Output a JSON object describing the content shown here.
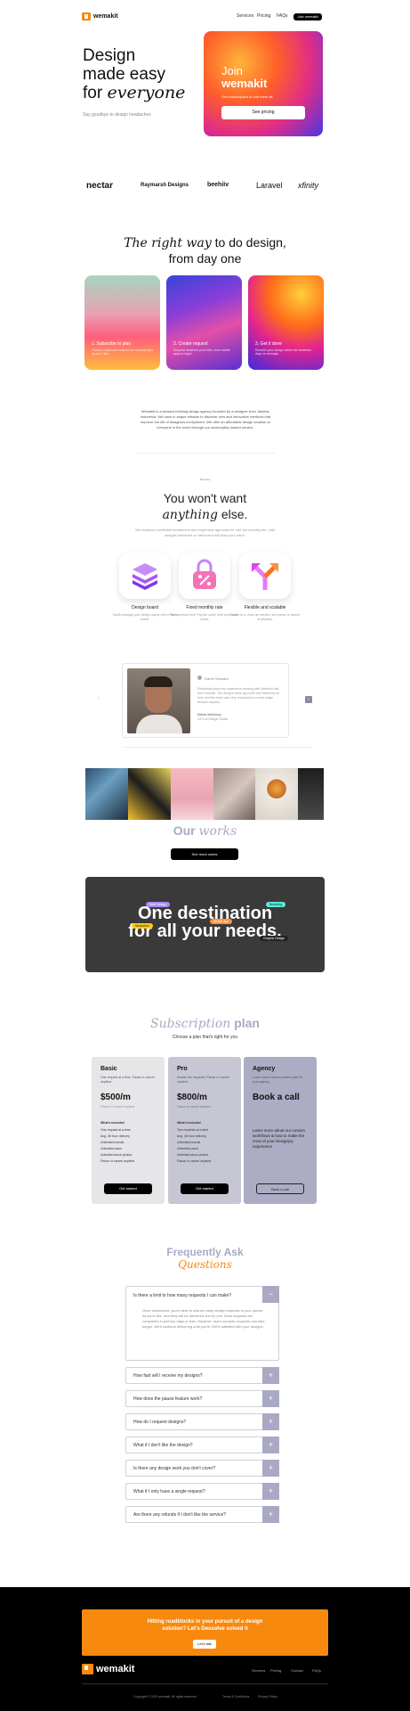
{
  "header": {
    "brand": "wemakit",
    "nav": [
      "Services",
      "Pricing",
      "FAQs"
    ],
    "cta": "Join wemakit"
  },
  "hero": {
    "line1": "Design",
    "line2": "made easy",
    "line3_plain": "for",
    "line3_italic": "everyone",
    "sub": "Say goodbye to design headaches",
    "card_title_1": "Join",
    "card_title_2": "wemakit",
    "card_sub": "One subscription to rule them all.",
    "card_btn": "See pricing"
  },
  "logos": [
    "nectar",
    "Raymarsh Designs",
    "beehiiv",
    "Laravel",
    "xfinity"
  ],
  "intro": {
    "title_italic": "The right way",
    "title_rest": "to do design,",
    "title_line2": "from day one"
  },
  "features": [
    {
      "title": "1. Subscribe to plan",
      "desc": "Choose a plan and request as many designs as you'd like."
    },
    {
      "title": "2. Create request",
      "desc": "Request whatever you'd like, from mobile apps to logos."
    },
    {
      "title": "3. Get it done",
      "desc": "Receive your design within two business days on average."
    }
  ],
  "about": {
    "p1": "Wemakit is a forward-thinking design agency founded by a designer from Jakarta, Indonesia. We have a unique mission to discover new and innovative methods that improve the life of designers everywhere. We offer an affordable design solution to everyone in the world through our subscription-based service."
  },
  "services_section": {
    "tag": "Services",
    "title1": "You won't want",
    "title2_italic": "anything",
    "title2_rest": "else.",
    "sub": "We replaced unreliable freelancers and expensive agencies for one flat monthly fee, with designs delivered so fast that it will blow your mind."
  },
  "services": [
    {
      "icon": "layers-icon",
      "title": "Design board",
      "desc": "Easily manage your design queue with a Trello board."
    },
    {
      "icon": "percent-icon",
      "title": "Fixed monthly rate",
      "desc": "No surprises here! Pay the same fixed price each month."
    },
    {
      "icon": "split-arrow-icon",
      "title": "Flexible and scalable",
      "desc": "Scale up or down as needed, and pause or cancel at anytime."
    }
  ],
  "testimonial": {
    "name": "Darrel Steward",
    "quote": "Everything about my experience working with Wemakit has been smooth. The designs were top notch and delivered on time, and the team was very responsive to every single revision request.",
    "author": "Marvin McKinney",
    "role": "CEO at Design Studio"
  },
  "works": {
    "title_plain": "Our",
    "title_italic": "works",
    "btn": "See more works"
  },
  "destination": {
    "line1": "One destination",
    "line2": "for all your needs.",
    "tags": [
      "Web Design",
      "Branding",
      "Mobile App",
      "Illustration",
      "Graphic Design"
    ]
  },
  "pricing": {
    "title_italic": "Subscription",
    "title_rest": "plan",
    "sub": "Choose a plan that's right for you",
    "plans": [
      {
        "name": "Basic",
        "sub": "One request at a time. Pause or cancel anytime.",
        "price": "$500/m",
        "price_note": "Pause or cancel anytime",
        "features_label": "What's included",
        "features": [
          "One request at a time",
          "Avg. 48 hour delivery",
          "Unlimited brands",
          "Unlimited users",
          "Unlimited stock photos",
          "Pause or cancel anytime"
        ],
        "btn": "Get started"
      },
      {
        "name": "Pro",
        "sub": "Double the requests. Pause or cancel anytime.",
        "price": "$800/m",
        "price_note": "Pause or cancel anytime",
        "features_label": "What's included",
        "features": [
          "Two requests at a time",
          "Avg. 48 hour delivery",
          "Unlimited brands",
          "Unlimited users",
          "Unlimited stock photos",
          "Pause or cancel anytime"
        ],
        "btn": "Get started"
      },
      {
        "name": "Agency",
        "sub": "Learn how to build a custom plan for your agency",
        "price": "Book a call",
        "note": "Learn more about our custom workflows & how to make the most of your Designjoy experience",
        "btn": "Book a call"
      }
    ]
  },
  "faq": {
    "title1": "Frequently Ask",
    "title2_italic": "Questions",
    "open_q": "Is there a limit to how many requests I can make?",
    "open_a": "Once subscribed, you're able to add as many design requests to your queue as you'd like, and they will be delivered one by one. Most requests are completed in just two days or less. However, more complex requests can take longer. We'll continue delivering until you're 100% satisfied with your designs.",
    "items": [
      "How fast will I receive my designs?",
      "How does the pause feature work?",
      "How do I request designs?",
      "What if I don't like the design?",
      "Is there any design work you don't cover?",
      "What if I only have a single request?",
      "Are there any refunds if I don't like the service?"
    ]
  },
  "footer": {
    "cta_text": "Hitting roadblocks in your pursuit of a design solution? Let's Dessolve solved it",
    "cta_btn": "Let's talk",
    "brand": "wemakit",
    "links": [
      "Services",
      "Pricing",
      "Contact",
      "FAQs"
    ],
    "copyright": "Copyright © 2023 wemakit. All rights reserved.",
    "legal": [
      "Terms & Conditions",
      "Privacy Policy"
    ]
  },
  "colors": {
    "accent": "#f7890f",
    "lavender": "#a9a9c4",
    "dark": "#3a3a3a"
  }
}
